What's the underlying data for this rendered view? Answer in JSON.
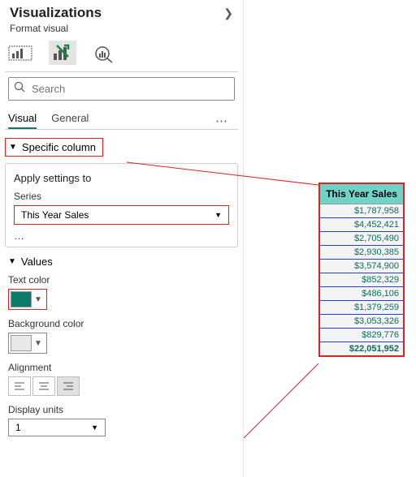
{
  "header": {
    "title": "Visualizations",
    "subtitle": "Format visual"
  },
  "search": {
    "placeholder": "Search"
  },
  "tabs": {
    "visual": "Visual",
    "general": "General"
  },
  "specific_column": {
    "label": "Specific column"
  },
  "apply": {
    "title": "Apply settings to",
    "series_label": "Series",
    "series_value": "This Year Sales"
  },
  "values": {
    "header": "Values",
    "text_color_label": "Text color",
    "text_color": "#0d7a6c",
    "bg_color_label": "Background color",
    "bg_color": "#e8e8e8",
    "alignment_label": "Alignment",
    "display_units_label": "Display units",
    "display_units_value": "1"
  },
  "table": {
    "header": "This Year Sales",
    "rows": [
      "$1,787,958",
      "$4,452,421",
      "$2,705,490",
      "$2,930,385",
      "$3,574,900",
      "$852,329",
      "$486,106",
      "$1,379,259",
      "$3,053,326",
      "$829,776"
    ],
    "total": "$22,051,952"
  }
}
